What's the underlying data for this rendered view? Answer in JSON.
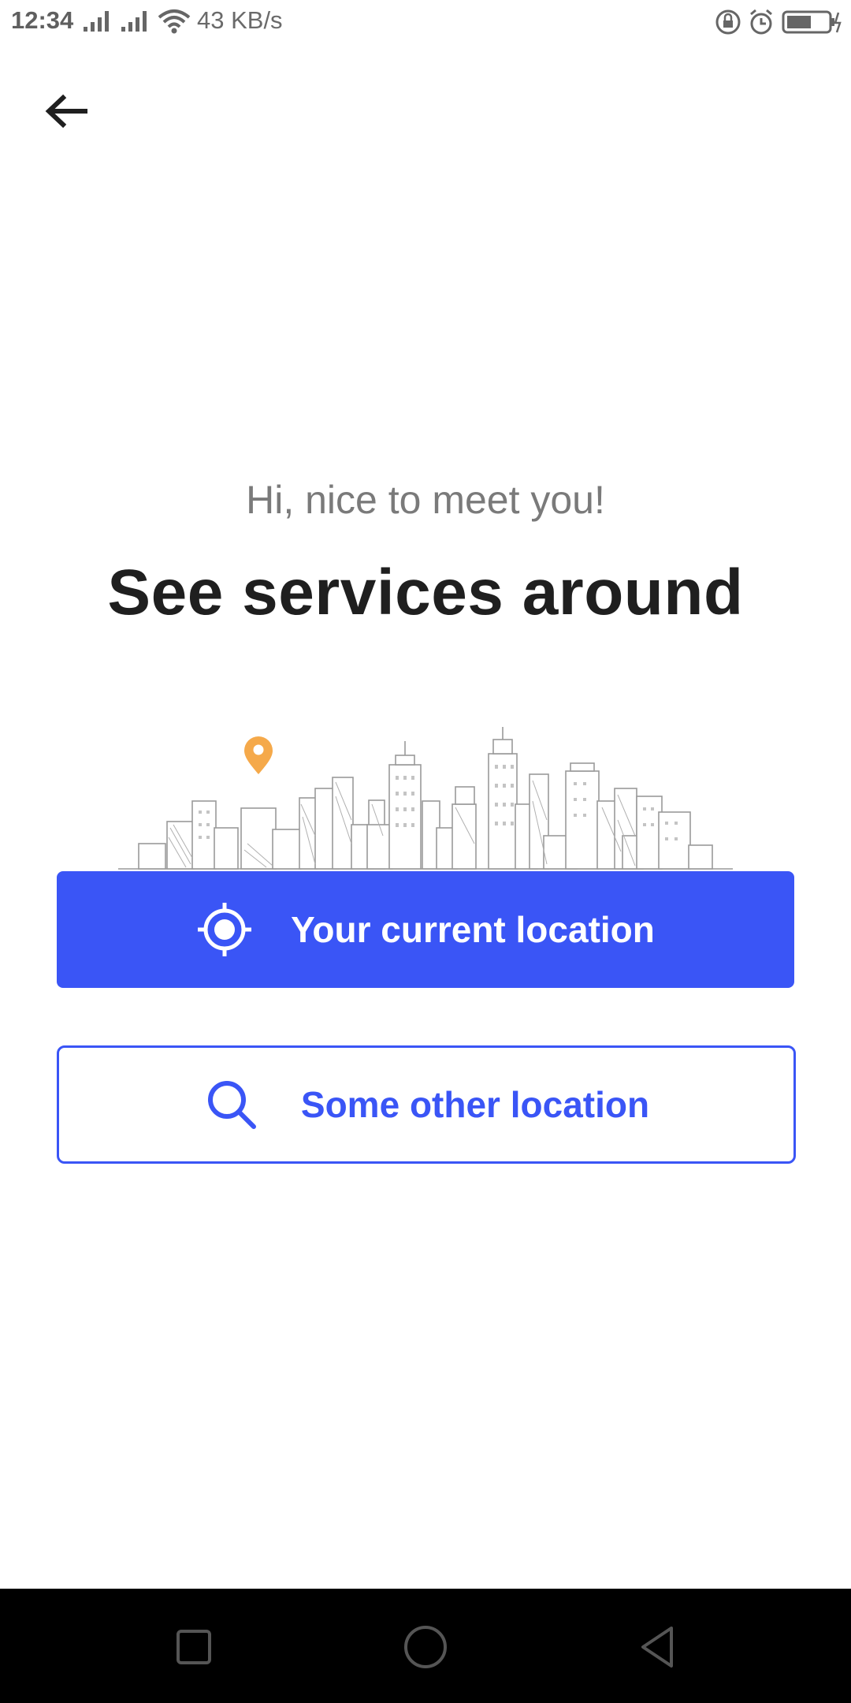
{
  "status_bar": {
    "time": "12:34",
    "network_speed": "43 KB/s"
  },
  "intro": {
    "greeting": "Hi, nice to meet you!",
    "headline": "See services around"
  },
  "actions": {
    "current_location_label": "Your current location",
    "other_location_label": "Some other location"
  },
  "colors": {
    "accent": "#3a55f6",
    "pin": "#f5a94a"
  },
  "icons": {
    "back": "arrow-left-icon",
    "current_location": "crosshair-icon",
    "other_location": "search-icon"
  }
}
